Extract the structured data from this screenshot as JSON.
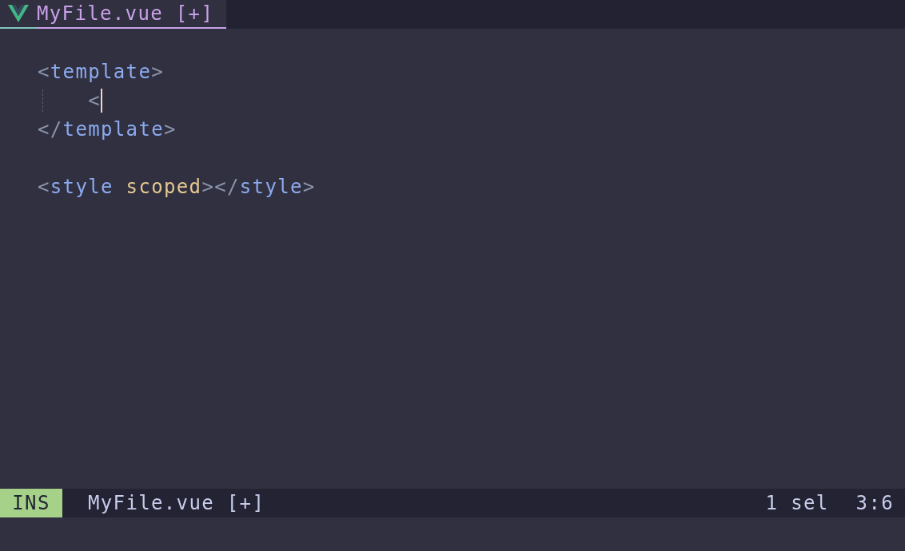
{
  "tabs": [
    {
      "label": "MyFile.vue [+]",
      "selected": true
    }
  ],
  "editor": {
    "lines": [
      {
        "tokens": [
          {
            "text": "<",
            "kind": "punct"
          },
          {
            "text": "template",
            "kind": "tag"
          },
          {
            "text": ">",
            "kind": "punct"
          }
        ]
      },
      {
        "indent_guide": true,
        "cursor": true,
        "tokens": [
          {
            "text": "    <",
            "kind": "punct"
          }
        ]
      },
      {
        "tokens": [
          {
            "text": "</",
            "kind": "punct"
          },
          {
            "text": "template",
            "kind": "tag"
          },
          {
            "text": ">",
            "kind": "punct"
          }
        ]
      },
      {
        "blank": true
      },
      {
        "tokens": [
          {
            "text": "<",
            "kind": "punct"
          },
          {
            "text": "style",
            "kind": "tag"
          },
          {
            "text": "scoped",
            "kind": "attr"
          },
          {
            "text": "></",
            "kind": "punct"
          },
          {
            "text": "style",
            "kind": "tag"
          },
          {
            "text": ">",
            "kind": "punct"
          }
        ]
      }
    ]
  },
  "status_bar": {
    "mode": "INS",
    "file": "MyFile.vue [+]",
    "selections": "1 sel",
    "position": "3:6"
  }
}
